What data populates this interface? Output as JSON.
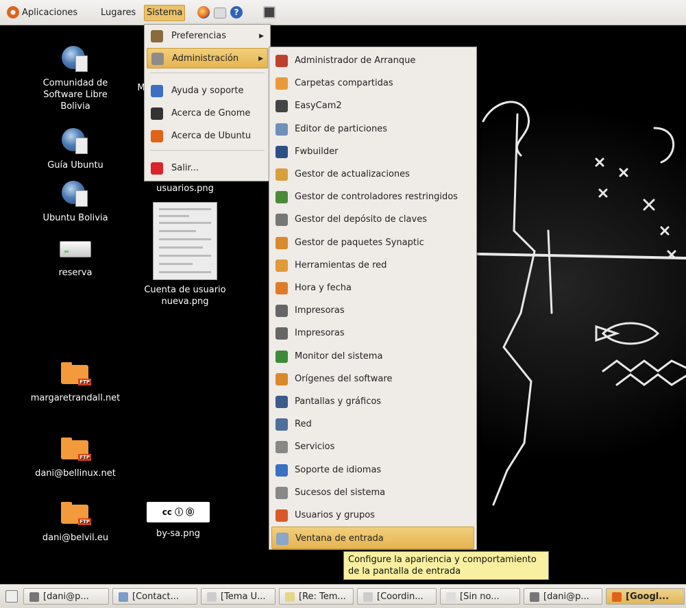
{
  "top_panel": {
    "menus": [
      "Aplicaciones",
      "Lugares",
      "Sistema"
    ],
    "launchers": [
      "firefox-icon",
      "evolution-mail-icon",
      "help-icon",
      "terminal-icon"
    ]
  },
  "desktop_icons": [
    {
      "label": "Comunidad de Software Libre Bolivia",
      "icon": "globe-document-icon"
    },
    {
      "label": "Guía Ubuntu",
      "icon": "globe-document-icon"
    },
    {
      "label": "Ubuntu Bolivia",
      "icon": "globe-document-icon"
    },
    {
      "label": "reserva",
      "icon": "drive-icon"
    },
    {
      "label": "margaretrandall.net",
      "icon": "ftp-folder-icon"
    },
    {
      "label": "dani@bellinux.net",
      "icon": "ftp-folder-icon"
    },
    {
      "label": "dani@belvil.eu",
      "icon": "ftp-folder-icon"
    },
    {
      "label": "usuarios.png",
      "icon": "image-icon"
    },
    {
      "label": "Cuenta de usuario nueva.png",
      "icon": "image-thumbnail"
    },
    {
      "label": "by-sa.png",
      "icon": "cc-by-sa-image"
    }
  ],
  "partial_label": "M",
  "ftp_badge": "FTP",
  "cc_badge": "cc ⓘ ⓪",
  "sistema_menu": {
    "items": [
      {
        "label": "Preferencias",
        "icon": "preferences-icon",
        "submenu": true,
        "color": "#8a6b3c"
      },
      {
        "label": "Administración",
        "icon": "administration-gear-icon",
        "submenu": true,
        "selected": true,
        "color": "#8c8c8c"
      },
      {
        "label": "Ayuda y soporte",
        "icon": "help-icon",
        "color": "#3a6fc4"
      },
      {
        "label": "Acerca de Gnome",
        "icon": "gnome-foot-icon",
        "color": "#333333"
      },
      {
        "label": "Acerca de Ubuntu",
        "icon": "ubuntu-logo-icon",
        "color": "#e0631a"
      },
      {
        "label": "Salir...",
        "icon": "power-icon",
        "color": "#d8242a"
      }
    ]
  },
  "admin_submenu": {
    "items": [
      {
        "label": "Administrador de Arranque",
        "icon": "boot-manager-icon",
        "color": "#c0412b"
      },
      {
        "label": "Carpetas compartidas",
        "icon": "shared-folder-icon",
        "color": "#e89a38"
      },
      {
        "label": "EasyCam2",
        "icon": "webcam-icon",
        "color": "#444444"
      },
      {
        "label": "Editor de particiones",
        "icon": "partition-editor-icon",
        "color": "#6e8fb8"
      },
      {
        "label": "Fwbuilder",
        "icon": "firewall-icon",
        "color": "#2c4f86"
      },
      {
        "label": "Gestor de actualizaciones",
        "icon": "update-manager-icon",
        "color": "#d9a03a"
      },
      {
        "label": "Gestor de controladores restringidos",
        "icon": "restricted-drivers-icon",
        "color": "#4c8a3a"
      },
      {
        "label": "Gestor del depósito de claves",
        "icon": "keyring-icon",
        "color": "#777777"
      },
      {
        "label": "Gestor de paquetes Synaptic",
        "icon": "synaptic-icon",
        "color": "#d88a2c"
      },
      {
        "label": "Herramientas de red",
        "icon": "network-tools-icon",
        "color": "#e09a3a"
      },
      {
        "label": "Hora y fecha",
        "icon": "clock-icon",
        "color": "#e07b2a"
      },
      {
        "label": "Impresoras",
        "icon": "printer-icon",
        "color": "#666666"
      },
      {
        "label": "Impresoras",
        "icon": "printer-icon",
        "color": "#666666"
      },
      {
        "label": "Monitor del sistema",
        "icon": "system-monitor-icon",
        "color": "#3c8a3c"
      },
      {
        "label": "Orígenes del software",
        "icon": "software-sources-icon",
        "color": "#d88a2c"
      },
      {
        "label": "Pantallas y gráficos",
        "icon": "display-icon",
        "color": "#3c5a8a"
      },
      {
        "label": "Red",
        "icon": "network-icon",
        "color": "#4f6f9c"
      },
      {
        "label": "Servicios",
        "icon": "services-icon",
        "color": "#888888"
      },
      {
        "label": "Soporte de idiomas",
        "icon": "language-flag-icon",
        "color": "#3a6fc4"
      },
      {
        "label": "Sucesos del sistema",
        "icon": "system-log-icon",
        "color": "#888888"
      },
      {
        "label": "Usuarios y grupos",
        "icon": "users-groups-icon",
        "color": "#d85a2a"
      },
      {
        "label": "Ventana de entrada",
        "icon": "login-window-icon",
        "selected": true,
        "color": "#8aa6c8"
      }
    ]
  },
  "tooltip": "Configure la apariencia y comportamiento de la pantalla de entrada",
  "taskbar": {
    "show_desktop_icon": "show-desktop-icon",
    "tasks": [
      {
        "label": "[dani@p...",
        "icon": "terminal-icon",
        "color": "#777777"
      },
      {
        "label": "[Contact...",
        "icon": "contacts-icon",
        "color": "#7a9cc6"
      },
      {
        "label": "[Tema U...",
        "icon": "mail-icon",
        "color": "#cccccc"
      },
      {
        "label": "[Re: Tem...",
        "icon": "compose-icon",
        "color": "#e6d68a"
      },
      {
        "label": "[Coordin...",
        "icon": "mail-icon",
        "color": "#cccccc"
      },
      {
        "label": "[Sin no...",
        "icon": "document-icon",
        "color": "#dddddd"
      },
      {
        "label": "[dani@p...",
        "icon": "terminal-icon",
        "color": "#777777"
      },
      {
        "label": "[Googl...",
        "icon": "firefox-icon",
        "color": "#e0631a",
        "active": true
      }
    ]
  }
}
